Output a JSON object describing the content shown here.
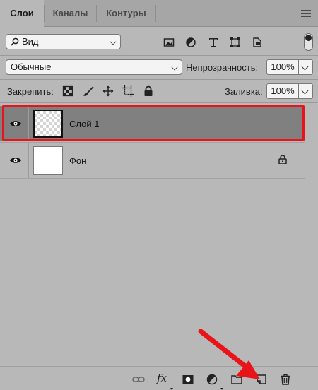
{
  "tabs": [
    {
      "label": "Слои",
      "active": true
    },
    {
      "label": "Каналы",
      "active": false
    },
    {
      "label": "Контуры",
      "active": false
    }
  ],
  "filter": {
    "kind_label": "Вид",
    "icons": [
      "image-filter-icon",
      "adjustment-filter-icon",
      "type-filter-icon",
      "shape-filter-icon",
      "smart-object-filter-icon"
    ]
  },
  "blend": {
    "mode": "Обычные",
    "opacity_label": "Непрозрачность:",
    "opacity_value": "100%"
  },
  "lock": {
    "label": "Закрепить:",
    "fill_label": "Заливка:",
    "fill_value": "100%"
  },
  "layers": [
    {
      "name": "Слой 1",
      "selected": true,
      "visible": true,
      "locked": false,
      "thumbnail": "transparent"
    },
    {
      "name": "Фон",
      "selected": false,
      "visible": true,
      "locked": true,
      "thumbnail": "white"
    }
  ],
  "bottom_icons": [
    "link-layers-icon",
    "fx-icon",
    "add-mask-icon",
    "adjustment-layer-icon",
    "new-group-icon",
    "new-layer-icon",
    "delete-layer-icon"
  ],
  "bottom": {
    "fx_label": "fx"
  },
  "colors": {
    "highlight": "#e8141a",
    "selected_row": "#808080",
    "panel": "#b8b8b8"
  }
}
